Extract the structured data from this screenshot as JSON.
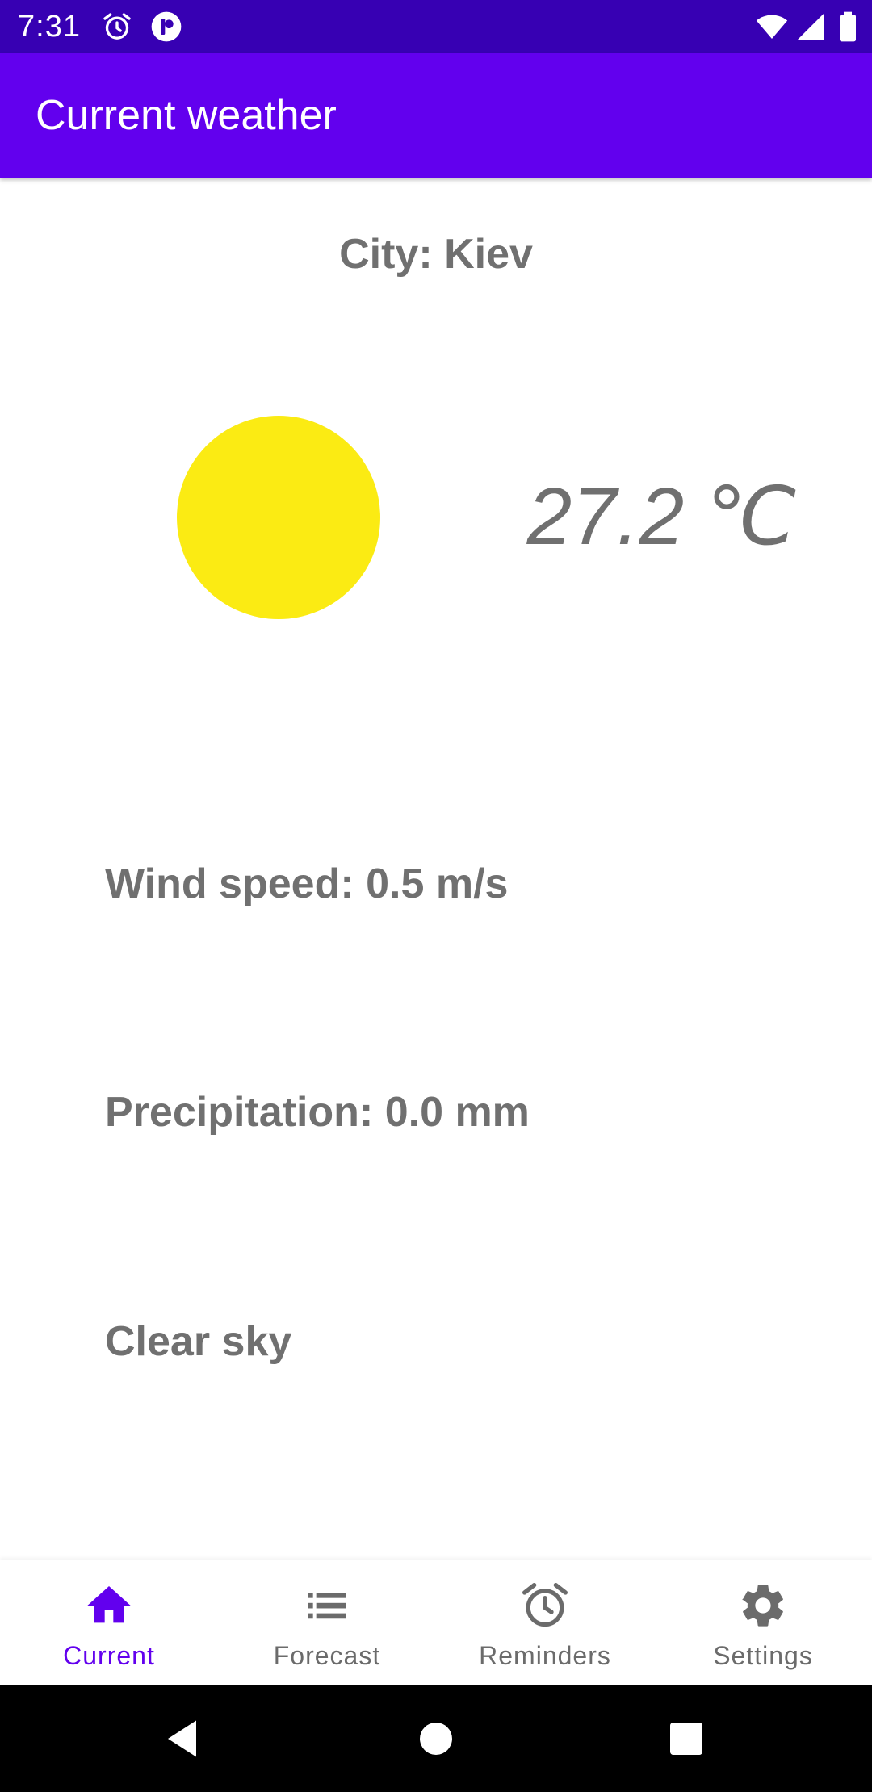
{
  "status_bar": {
    "time": "7:31",
    "icons": [
      "alarm-icon",
      "app-notification-icon",
      "wifi-icon",
      "cell-signal-icon",
      "battery-icon"
    ]
  },
  "app_bar": {
    "title": "Current weather",
    "color": "#6200ee"
  },
  "weather": {
    "city": "City: Kiev",
    "temperature": "27.2 ℃",
    "condition_icon": "sun-icon",
    "sun_color": "#fbeb13",
    "wind": "Wind speed: 0.5 m/s",
    "precipitation": "Precipitation: 0.0 mm",
    "description": "Clear sky"
  },
  "bottom_nav": {
    "active_color": "#6200ee",
    "items": [
      {
        "label": "Current",
        "icon": "home-icon",
        "active": true
      },
      {
        "label": "Forecast",
        "icon": "list-icon",
        "active": false
      },
      {
        "label": "Reminders",
        "icon": "alarm-icon",
        "active": false
      },
      {
        "label": "Settings",
        "icon": "gear-icon",
        "active": false
      }
    ]
  },
  "system_nav": {
    "buttons": [
      "back-icon",
      "home-circle-icon",
      "recents-icon"
    ]
  }
}
